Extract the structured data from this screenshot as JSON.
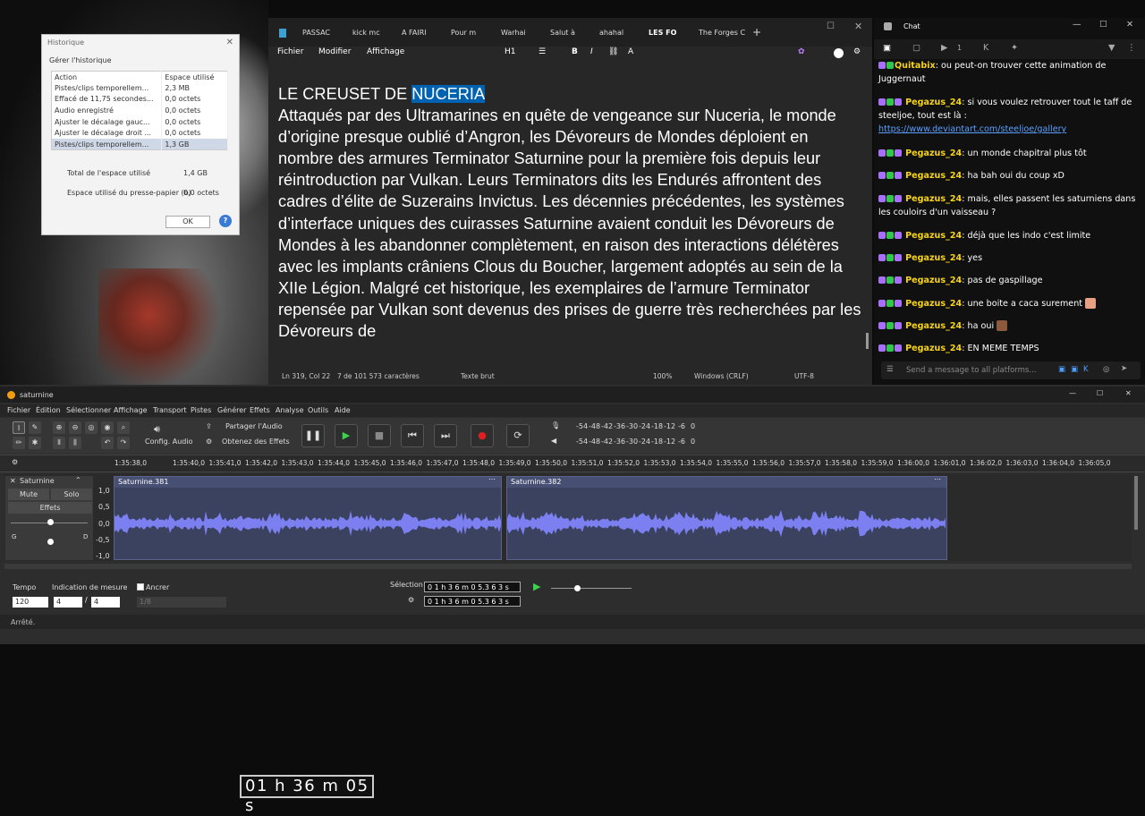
{
  "history": {
    "title": "Historique",
    "group": "Gérer l'historique",
    "col_action": "Action",
    "col_space": "Espace utilisé",
    "rows": [
      [
        "Pistes/clips temporellem...",
        "2,3 MB"
      ],
      [
        "Effacé de 11,75 secondes...",
        "0,0 octets"
      ],
      [
        "Audio enregistré",
        "0,0 octets"
      ],
      [
        "Ajuster le décalage gauc...",
        "0,0 octets"
      ],
      [
        "Ajuster le décalage droit ...",
        "0,0 octets"
      ],
      [
        "Pistes/clips temporellem...",
        "1,3 GB"
      ]
    ],
    "total_label": "Total de l'espace utilisé",
    "total_value": "1,4 GB",
    "clipboard_label": "Espace utilisé du presse-papier (b)",
    "clipboard_value": "0,0 octets",
    "ok": "OK",
    "help": "?"
  },
  "notepad": {
    "tabs": [
      "PASSAC",
      "kick mc",
      "A FAIRI",
      "Pour m",
      "Warhai",
      "Salut à",
      "ahahal",
      "LES FO",
      "The Forges C"
    ],
    "menu": {
      "file": "Fichier",
      "edit": "Modifier",
      "view": "Affichage",
      "heading": "H1",
      "bold": "B",
      "italic": "I"
    },
    "doc_title": "LE CREUSET DE ",
    "doc_title_hl": "NUCERIA",
    "body": "Attaqués par des Ultramarines en quête de vengeance sur Nuceria, le monde d’origine presque oublié d’Angron, les Dévoreurs de Mondes déploient en nombre des armures Terminator Saturnine pour la première fois depuis leur réintroduction par Vulkan. Leurs Terminators dits les Endurés affrontent des cadres d’élite de Suzerains Invictus. Les décennies précédentes, les systèmes d’interface uniques des cuirasses Saturnine avaient conduit les Dévoreurs de Mondes à les abandonner complètement, en raison des interactions délétères avec les implants crâniens Clous du Boucher, largement adoptés au sein de la XIIe Légion. Malgré cet historique, les exemplaires de l’armure Terminator repensée par Vulkan sont devenus des prises de guerre très recherchées par les Dévoreurs de",
    "status": {
      "pos": "Ln 319, Col 22",
      "chars": "7 de 101 573 caractères",
      "mode": "Texte brut",
      "zoom": "100%",
      "eol": "Windows (CRLF)",
      "enc": "UTF-8"
    }
  },
  "chat": {
    "title": "Chat",
    "tab_count": "1",
    "messages": [
      {
        "user": "Quitabix",
        "text": ": ou peut-on trouver cette animation de Juggernaut"
      },
      {
        "user": "Pegazus_24",
        "text": ": si vous voulez retrouver tout le taff de steeljoe, tout est là :",
        "link": "https://www.deviantart.com/steeljoe/gallery"
      },
      {
        "user": "Pegazus_24",
        "text": ": un monde chapitral plus tôt"
      },
      {
        "user": "Pegazus_24",
        "text": ": ha bah oui du coup xD"
      },
      {
        "user": "Pegazus_24",
        "text": ": mais, elles passent les saturniens dans les couloirs d'un vaisseau ?"
      },
      {
        "user": "Pegazus_24",
        "text": ": déjà que les indo c'est limite"
      },
      {
        "user": "Pegazus_24",
        "text": ": yes"
      },
      {
        "user": "Pegazus_24",
        "text": ": pas de gaspillage"
      },
      {
        "user": "Pegazus_24",
        "text": ": une boite a caca surement"
      },
      {
        "user": "Pegazus_24",
        "text": ": ha oui"
      },
      {
        "user": "Pegazus_24",
        "text": ": EN MEME TEMPS"
      }
    ],
    "placeholder": "Send a message to all platforms..."
  },
  "audacity": {
    "title": "saturnine",
    "menu": [
      "Fichier",
      "Édition",
      "Sélectionner",
      "Affichage",
      "Transport",
      "Pistes",
      "Générer",
      "Effets",
      "Analyse",
      "Outils",
      "Aide"
    ],
    "audio_setup": "Config. Audio",
    "share": "Partager l'Audio",
    "get_effects": "Obtenez des Effets",
    "meter_ticks": [
      "-54",
      "-48",
      "-42",
      "-36",
      "-30",
      "-24",
      "-18",
      "-12",
      "-6",
      "0"
    ],
    "ruler": [
      "1:35:38,0",
      "1:35:40,0",
      "1:35:41,0",
      "1:35:42,0",
      "1:35:43,0",
      "1:35:44,0",
      "1:35:45,0",
      "1:35:46,0",
      "1:35:47,0",
      "1:35:48,0",
      "1:35:49,0",
      "1:35:50,0",
      "1:35:51,0",
      "1:35:52,0",
      "1:35:53,0",
      "1:35:54,0",
      "1:35:55,0",
      "1:35:56,0",
      "1:35:57,0",
      "1:35:58,0",
      "1:35:59,0",
      "1:36:00,0",
      "1:36:01,0",
      "1:36:02,0",
      "1:36:03,0",
      "1:36:04,0",
      "1:36:05,0"
    ],
    "track": {
      "name": "Saturnine",
      "mute": "Mute",
      "solo": "Solo",
      "effects": "Effets",
      "pan_l": "G",
      "pan_r": "D"
    },
    "scale": [
      "1,0",
      "0,5",
      "0,0",
      "-0,5",
      "-1,0"
    ],
    "clip1": "Saturnine.381",
    "clip2": "Saturnine.382",
    "tempo_label": "Tempo",
    "tempo": "120",
    "sig_label": "Indication de mesure",
    "sig_num": "4",
    "sig_den": "4",
    "snap": "Ancrer",
    "snap_val": "1/8",
    "time": "01 h 36 m 05 s",
    "sel_label": "Sélection",
    "sel_start": "0 1 h 3 6 m 0 5.3 6 3 s",
    "sel_end": "0 1 h 3 6 m 0 5.3 6 3 s",
    "status": "Arrêté."
  }
}
